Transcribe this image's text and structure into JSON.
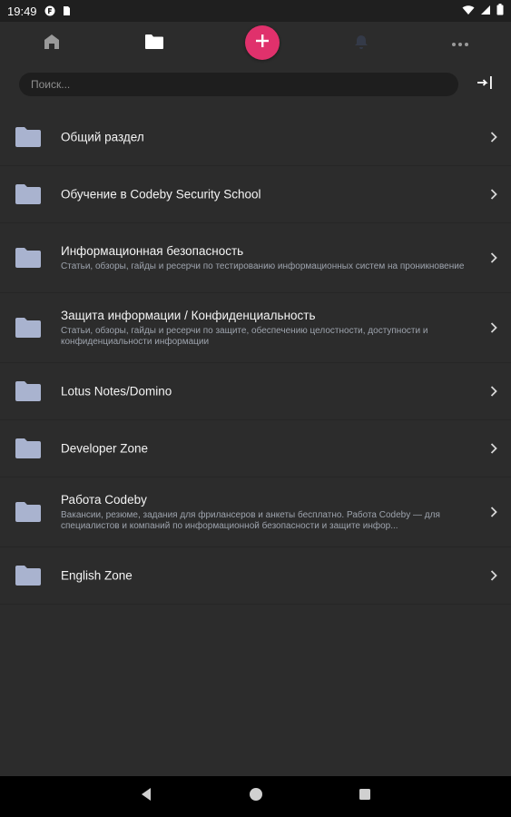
{
  "status_bar": {
    "time": "19:49"
  },
  "search": {
    "placeholder": "Поиск..."
  },
  "forums": [
    {
      "title": "Общий раздел",
      "description": ""
    },
    {
      "title": "Обучение в Codeby Security School",
      "description": ""
    },
    {
      "title": "Информационная безопасность",
      "description": "Статьи, обзоры, гайды и ресерчи по тестированию информационных систем на проникновение"
    },
    {
      "title": "Защита информации / Конфиденциальность",
      "description": "Статьи, обзоры, гайды и ресерчи по защите, обеспечению целостности, доступности и конфиденциальности информации"
    },
    {
      "title": "Lotus Notes/Domino",
      "description": ""
    },
    {
      "title": "Developer Zone",
      "description": ""
    },
    {
      "title": "Работа Codeby",
      "description": "Вакансии, резюме, задания для фрилансеров и анкеты бесплатно. Работа Codeby — для специалистов и компаний по информационной безопасности и защите инфор..."
    },
    {
      "title": "English Zone",
      "description": ""
    }
  ],
  "colors": {
    "background": "#2c2c2c",
    "accent": "#e0316c",
    "folder": "#a9b3cf",
    "status_bar": "#1f1f1f",
    "nav_bar": "#000000"
  },
  "icons": {
    "nav": [
      "home-icon",
      "folder-icon",
      "plus-icon",
      "bell-icon",
      "more-icon"
    ],
    "login": "login-icon",
    "system_nav": [
      "back-icon",
      "home-circle-icon",
      "recents-icon"
    ]
  }
}
